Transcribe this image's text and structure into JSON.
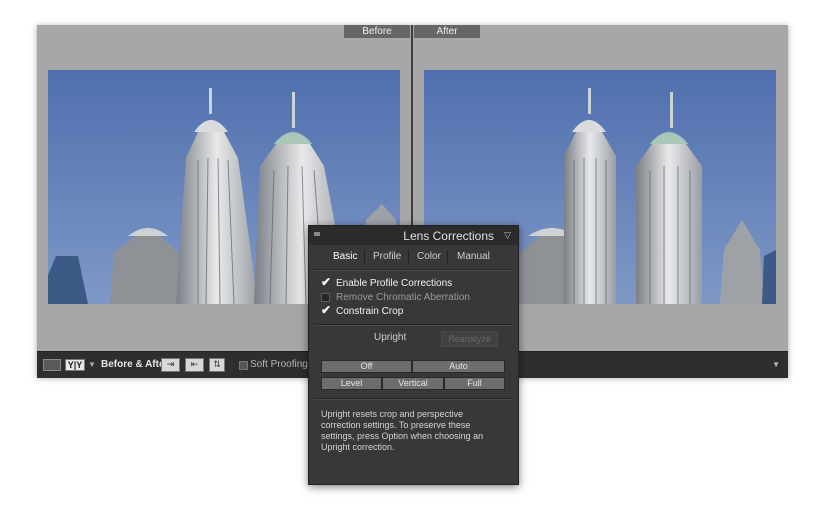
{
  "viewer": {
    "before_label": "Before",
    "after_label": "After"
  },
  "toolbar": {
    "loupe_icon": "single-view-icon",
    "yy_label": "Y|Y",
    "before_after_label": "Before & After :",
    "swap_icons": [
      "copy-before-to-after-icon",
      "copy-after-to-before-icon",
      "swap-before-after-icon"
    ],
    "soft_proofing_label": "Soft Proofing"
  },
  "panel": {
    "title": "Lens Corrections",
    "tabs": [
      {
        "label": "Basic",
        "active": true
      },
      {
        "label": "Profile",
        "active": false
      },
      {
        "label": "Color",
        "active": false
      },
      {
        "label": "Manual",
        "active": false
      }
    ],
    "options": [
      {
        "label": "Enable Profile Corrections",
        "checked": true
      },
      {
        "label": "Remove Chromatic Aberration",
        "checked": false
      },
      {
        "label": "Constrain Crop",
        "checked": true
      }
    ],
    "upright_label": "Upright",
    "reanalyze_label": "Reanalyze",
    "upright_row1": [
      "Off",
      "Auto"
    ],
    "upright_row2": [
      "Level",
      "Vertical",
      "Full"
    ],
    "description": "Upright resets crop and perspective correction settings. To preserve these settings, press Option when choosing an Upright correction."
  }
}
